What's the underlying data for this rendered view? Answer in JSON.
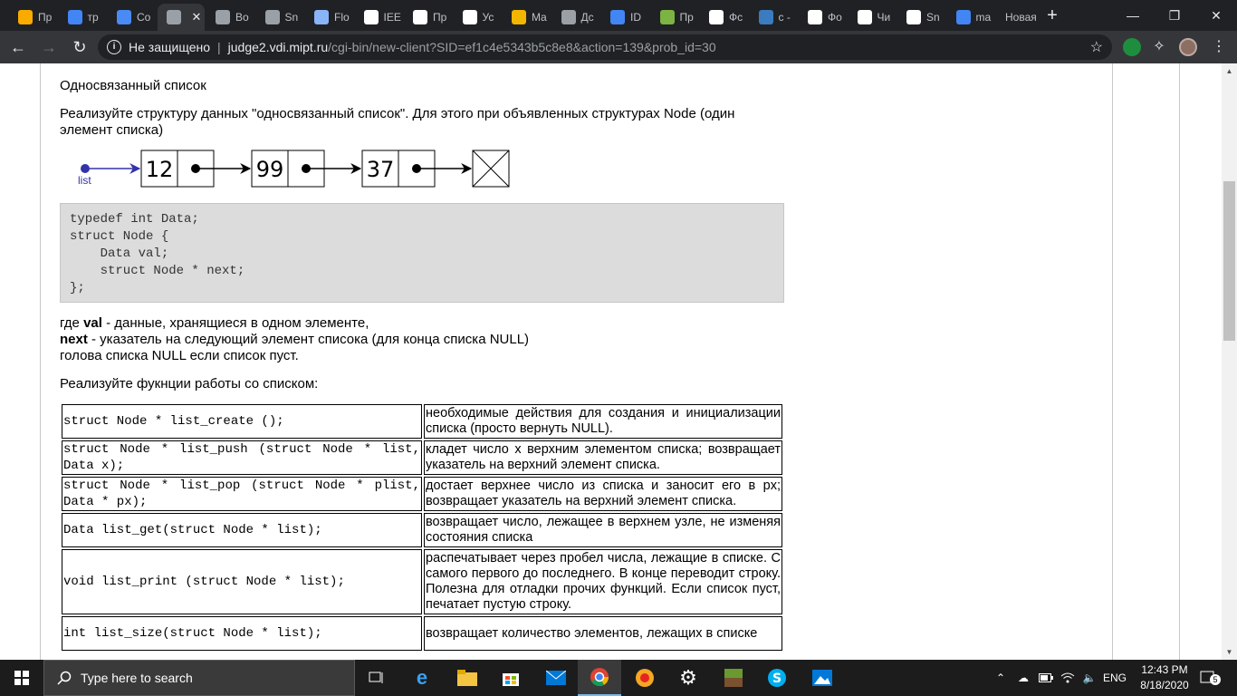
{
  "browser": {
    "tabs": [
      {
        "title": "Пр",
        "favicon": "bookmarks-icon",
        "color": "#f9ab00"
      },
      {
        "title": "тр",
        "favicon": "google-icon",
        "color": "#4285f4"
      },
      {
        "title": "Co",
        "favicon": "chat-icon",
        "color": "#4a8af4"
      },
      {
        "title": "",
        "favicon": "globe-icon",
        "color": "#9aa0a6",
        "active": true
      },
      {
        "title": "Во",
        "favicon": "globe-icon",
        "color": "#9aa0a6"
      },
      {
        "title": "Sn",
        "favicon": "globe-icon",
        "color": "#9aa0a6"
      },
      {
        "title": "Flo",
        "favicon": "arrow-icon",
        "color": "#8ab4f8"
      },
      {
        "title": "IEE",
        "favicon": "wikipedia-icon",
        "color": "#ffffff"
      },
      {
        "title": "Пр",
        "favicon": "dp-icon",
        "color": "#ffffff"
      },
      {
        "title": "Ус",
        "favicon": "globe-icon",
        "color": "#ffffff"
      },
      {
        "title": "Ma",
        "favicon": "m-icon",
        "color": "#f2b500"
      },
      {
        "title": "Дс",
        "favicon": "globe-icon",
        "color": "#9aa0a6"
      },
      {
        "title": "ID",
        "favicon": "calendar-icon",
        "color": "#4285f4"
      },
      {
        "title": "Пр",
        "favicon": "book-icon",
        "color": "#7cb342"
      },
      {
        "title": "Фс",
        "favicon": "page-icon",
        "color": "#ffffff"
      },
      {
        "title": "с -",
        "favicon": "stack-icon",
        "color": "#3b7bbf"
      },
      {
        "title": "Фо",
        "favicon": "page-icon",
        "color": "#ffffff"
      },
      {
        "title": "Чи",
        "favicon": "wikipedia-icon",
        "color": "#ffffff"
      },
      {
        "title": "Sn",
        "favicon": "globe-icon",
        "color": "#ffffff"
      },
      {
        "title": "ma",
        "favicon": "google-icon",
        "color": "#4285f4"
      },
      {
        "title": "Новая",
        "favicon": "",
        "color": "#9aa0a6"
      }
    ],
    "security_label": "Не защищено",
    "url_host": "judge2.vdi.mipt.ru",
    "url_rest": "/cgi-bin/new-client?SID=ef1c4e5343b5c8e8&action=139&prob_id=30"
  },
  "page": {
    "title": "Односвязанный список",
    "intro": "Реализуйте структуру данных \"односвязанный список\". Для этого при объявленных структурах Node (один элемент списка)",
    "diagram": {
      "head_label": "list",
      "nodes": [
        "12",
        "99",
        "37"
      ]
    },
    "code": "typedef int Data;\nstruct Node {\n    Data val;\n    struct Node * next;\n};",
    "desc": {
      "line1_pre": "где ",
      "line1_bold": "val",
      "line1_post": " - данные, хранящиеся в одном элементе,",
      "line2_bold": "next",
      "line2_post": " - указатель на следующий элемент списока (для конца списка NULL)",
      "line3": "голова списка NULL если список пуст."
    },
    "funcs_title": "Реализуйте фукнции работы со списком:",
    "functions": [
      {
        "sig": "struct Node * list_create ();",
        "desc": "необходимые действия для создания и инициализации списка (просто вернуть NULL)."
      },
      {
        "sig": "struct Node * list_push (struct Node * list, Data x);",
        "desc": "кладет число x верхним элементом списка; возвращает указатель на верхний элемент списка."
      },
      {
        "sig": "struct Node * list_pop (struct Node * plist, Data * px);",
        "desc": "достает верхнее число из списка и заносит его в px; возвращает указатель на верхний элемент списка."
      },
      {
        "sig": "Data list_get(struct Node * list);",
        "desc": "возвращает число, лежащее в верхнем узле, не изменяя состояния списка"
      },
      {
        "sig": "void list_print (struct Node * list);",
        "desc": "распечатывает через пробел числа, лежащие в списке. С самого первого до последнего. В конце переводит строку. Полезна для отладки прочих функций. Если список пуст, печатает пустую строку."
      },
      {
        "sig": "int list_size(struct Node * list);",
        "desc": "возвращает количество элементов, лежащих в списке"
      }
    ]
  },
  "taskbar": {
    "search_placeholder": "Type here to search",
    "language": "ENG",
    "time": "12:43 PM",
    "date": "8/18/2020",
    "notification_count": "5"
  }
}
